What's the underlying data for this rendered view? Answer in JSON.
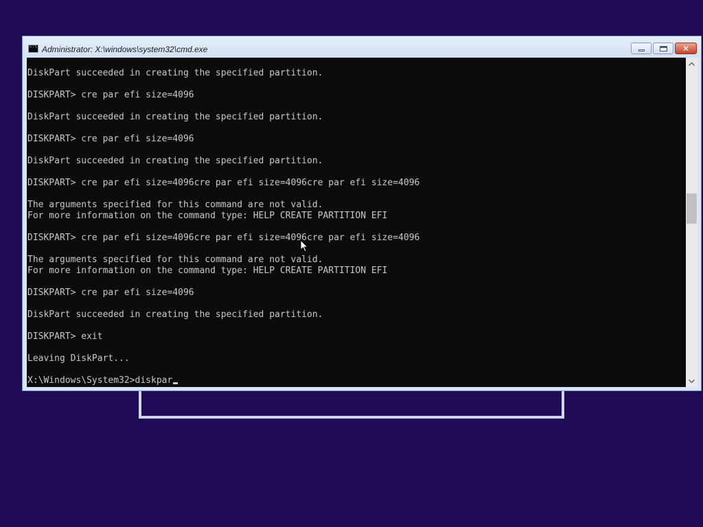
{
  "window": {
    "title": "Administrator: X:\\windows\\system32\\cmd.exe",
    "minimize_symbol": "",
    "maximize_symbol": "",
    "close_symbol": "✕"
  },
  "console": {
    "lines": [
      "DiskPart succeeded in creating the specified partition.",
      "",
      "DISKPART> cre par efi size=4096",
      "",
      "DiskPart succeeded in creating the specified partition.",
      "",
      "DISKPART> cre par efi size=4096",
      "",
      "DiskPart succeeded in creating the specified partition.",
      "",
      "DISKPART> cre par efi size=4096cre par efi size=4096cre par efi size=4096",
      "",
      "The arguments specified for this command are not valid.",
      "For more information on the command type: HELP CREATE PARTITION EFI",
      "",
      "DISKPART> cre par efi size=4096cre par efi size=4096cre par efi size=4096",
      "",
      "The arguments specified for this command are not valid.",
      "For more information on the command type: HELP CREATE PARTITION EFI",
      "",
      "DISKPART> cre par efi size=4096",
      "",
      "DiskPart succeeded in creating the specified partition.",
      "",
      "DISKPART> exit",
      "",
      "Leaving DiskPart...",
      ""
    ],
    "prompt_line": "X:\\Windows\\System32>diskpar"
  },
  "icons": {
    "window_icon": "cmd-icon",
    "scroll_up": "chevron-up-icon",
    "scroll_down": "chevron-down-icon",
    "pointer": "mouse-pointer-icon"
  },
  "colors": {
    "desktop_background": "#1f0a56",
    "console_background": "#0c0c0c",
    "console_text": "#c8c8c8",
    "close_button": "#c7432a"
  }
}
